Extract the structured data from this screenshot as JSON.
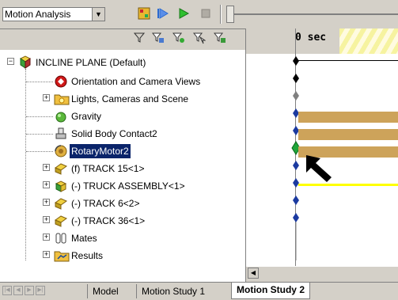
{
  "toolbar": {
    "study_type": "Motion Analysis",
    "icons": [
      "calculator-icon",
      "play-from-start-icon",
      "play-icon",
      "stop-icon"
    ]
  },
  "tree": {
    "filter_icons": [
      "filter-icon",
      "filter-animation-icon",
      "filter-driving-icon",
      "filter-selected-icon",
      "filter-results-icon"
    ],
    "items": [
      {
        "label": "INCLINE PLANE  (Default)",
        "icon": "assembly-icon",
        "expanded": true
      },
      {
        "label": "Orientation and Camera Views",
        "icon": "camera-views-icon"
      },
      {
        "label": "Lights, Cameras and Scene",
        "icon": "lights-folder-icon"
      },
      {
        "label": "Gravity",
        "icon": "gravity-icon"
      },
      {
        "label": "Solid Body Contact2",
        "icon": "contact-icon"
      },
      {
        "label": "RotaryMotor2",
        "icon": "rotary-motor-icon",
        "selected": true
      },
      {
        "label": "(f) TRACK 15<1>",
        "icon": "part-icon"
      },
      {
        "label": "(-) TRUCK ASSEMBLY<1>",
        "icon": "subassembly-icon"
      },
      {
        "label": "(-) TRACK 6<2>",
        "icon": "part-icon"
      },
      {
        "label": "(-) TRACK 36<1>",
        "icon": "part-icon"
      },
      {
        "label": "Mates",
        "icon": "mates-icon"
      },
      {
        "label": "Results",
        "icon": "results-icon"
      }
    ]
  },
  "timeline": {
    "time_label": "0 sec",
    "colors": {
      "bar": "#cda35a",
      "motor_bar": "#ffff00",
      "key_blue": "#1b3aa0",
      "key_green": "#1fa53a"
    }
  },
  "tabs": {
    "items": [
      "Model",
      "Motion Study 1",
      "Motion Study 2"
    ],
    "active": "Motion Study 2"
  }
}
